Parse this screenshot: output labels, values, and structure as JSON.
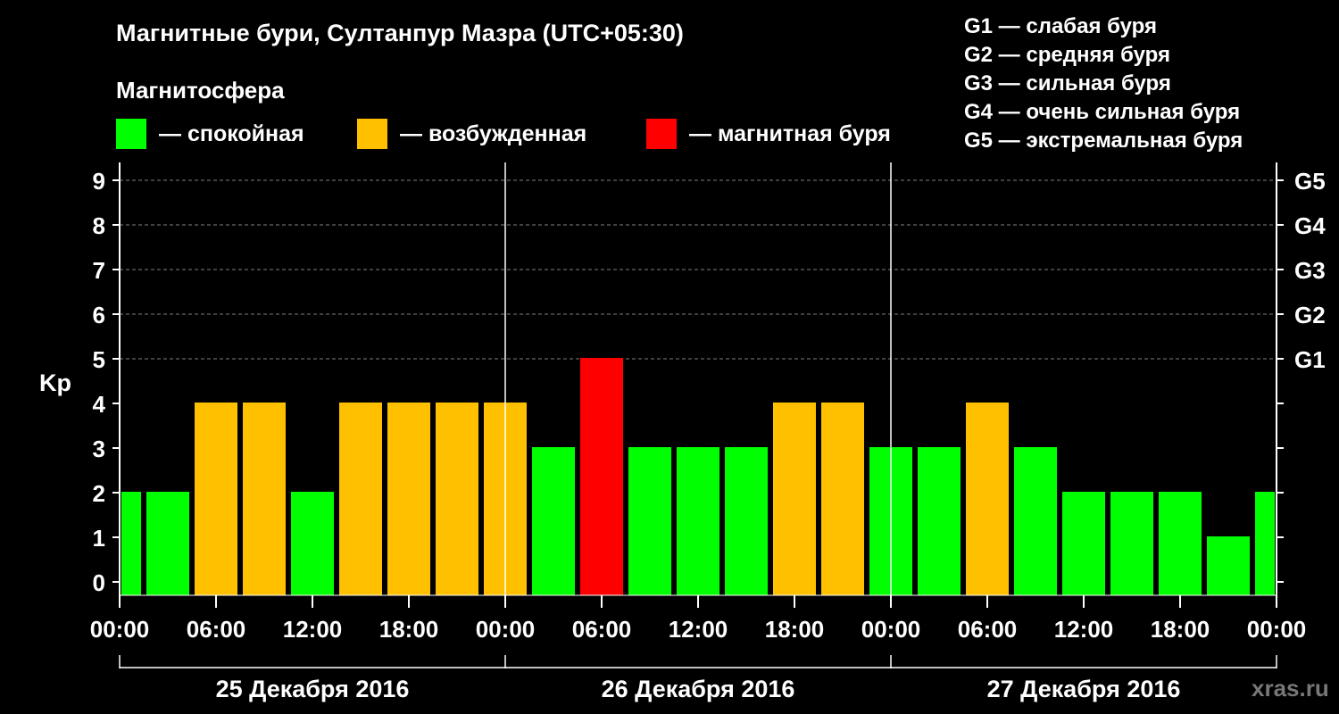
{
  "header": {
    "title": "Магнитные бури, Султанпур Мазра (UTC+05:30)",
    "subtitle": "Магнитосфера"
  },
  "legend": [
    {
      "label": "— спокойная",
      "color": "#00ff00"
    },
    {
      "label": "— возбужденная",
      "color": "#ffc000"
    },
    {
      "label": "— магнитная буря",
      "color": "#ff0000"
    }
  ],
  "storm_levels": [
    "G1 — слабая буря",
    "G2 — средняя буря",
    "G3 — сильная буря",
    "G4 — очень сильная буря",
    "G5 — экстремальная буря"
  ],
  "watermark": "xras.ru",
  "chart_data": {
    "type": "bar",
    "ylabel": "Kp",
    "ylim": [
      0,
      9
    ],
    "y_ticks": [
      "0",
      "1",
      "2",
      "3",
      "4",
      "5",
      "6",
      "7",
      "8",
      "9"
    ],
    "right_axis_labels": [
      {
        "value": 5,
        "label": "G1"
      },
      {
        "value": 6,
        "label": "G2"
      },
      {
        "value": 7,
        "label": "G3"
      },
      {
        "value": 8,
        "label": "G4"
      },
      {
        "value": 9,
        "label": "G5"
      }
    ],
    "x_tick_labels": [
      "00:00",
      "06:00",
      "12:00",
      "18:00",
      "00:00",
      "06:00",
      "12:00",
      "18:00",
      "00:00",
      "06:00",
      "12:00",
      "18:00",
      "00:00"
    ],
    "days": [
      "25 Декабря 2016",
      "26 Декабря 2016",
      "27 Декабря 2016"
    ],
    "grid": "dashed horizontal",
    "colors": {
      "quiet": "#00ff00",
      "active": "#ffc000",
      "storm": "#ff0000"
    },
    "bars": [
      {
        "start_hour": 0,
        "end_hour": 1.5,
        "kp": 2,
        "color": "#00ff00"
      },
      {
        "start_hour": 1.5,
        "end_hour": 4.5,
        "kp": 2,
        "color": "#00ff00"
      },
      {
        "start_hour": 4.5,
        "end_hour": 7.5,
        "kp": 4,
        "color": "#ffc000"
      },
      {
        "start_hour": 7.5,
        "end_hour": 10.5,
        "kp": 4,
        "color": "#ffc000"
      },
      {
        "start_hour": 10.5,
        "end_hour": 13.5,
        "kp": 2,
        "color": "#00ff00"
      },
      {
        "start_hour": 13.5,
        "end_hour": 16.5,
        "kp": 4,
        "color": "#ffc000"
      },
      {
        "start_hour": 16.5,
        "end_hour": 19.5,
        "kp": 4,
        "color": "#ffc000"
      },
      {
        "start_hour": 19.5,
        "end_hour": 22.5,
        "kp": 4,
        "color": "#ffc000"
      },
      {
        "start_hour": 22.5,
        "end_hour": 25.5,
        "kp": 4,
        "color": "#ffc000"
      },
      {
        "start_hour": 25.5,
        "end_hour": 28.5,
        "kp": 3,
        "color": "#00ff00"
      },
      {
        "start_hour": 28.5,
        "end_hour": 31.5,
        "kp": 5,
        "color": "#ff0000"
      },
      {
        "start_hour": 31.5,
        "end_hour": 34.5,
        "kp": 3,
        "color": "#00ff00"
      },
      {
        "start_hour": 34.5,
        "end_hour": 37.5,
        "kp": 3,
        "color": "#00ff00"
      },
      {
        "start_hour": 37.5,
        "end_hour": 40.5,
        "kp": 3,
        "color": "#00ff00"
      },
      {
        "start_hour": 40.5,
        "end_hour": 43.5,
        "kp": 4,
        "color": "#ffc000"
      },
      {
        "start_hour": 43.5,
        "end_hour": 46.5,
        "kp": 4,
        "color": "#ffc000"
      },
      {
        "start_hour": 46.5,
        "end_hour": 49.5,
        "kp": 3,
        "color": "#00ff00"
      },
      {
        "start_hour": 49.5,
        "end_hour": 52.5,
        "kp": 3,
        "color": "#00ff00"
      },
      {
        "start_hour": 52.5,
        "end_hour": 55.5,
        "kp": 4,
        "color": "#ffc000"
      },
      {
        "start_hour": 55.5,
        "end_hour": 58.5,
        "kp": 3,
        "color": "#00ff00"
      },
      {
        "start_hour": 58.5,
        "end_hour": 61.5,
        "kp": 2,
        "color": "#00ff00"
      },
      {
        "start_hour": 61.5,
        "end_hour": 64.5,
        "kp": 2,
        "color": "#00ff00"
      },
      {
        "start_hour": 64.5,
        "end_hour": 67.5,
        "kp": 2,
        "color": "#00ff00"
      },
      {
        "start_hour": 67.5,
        "end_hour": 70.5,
        "kp": 1,
        "color": "#00ff00"
      },
      {
        "start_hour": 70.5,
        "end_hour": 72,
        "kp": 2,
        "color": "#00ff00"
      }
    ]
  }
}
